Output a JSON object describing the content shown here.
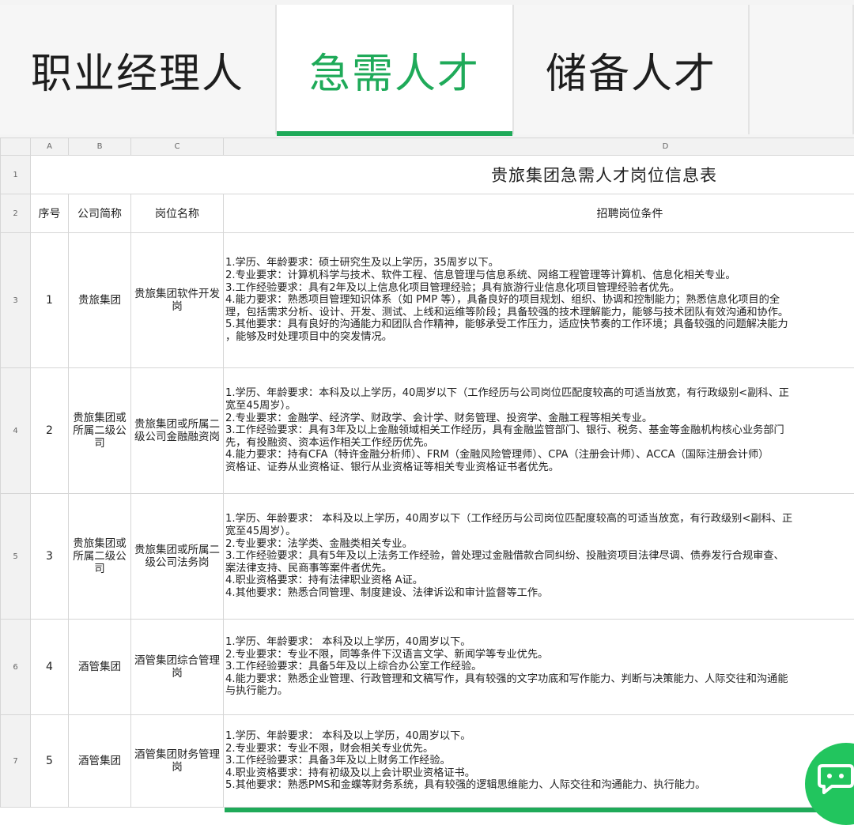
{
  "tabs": [
    {
      "label": "职业经理人",
      "active": false
    },
    {
      "label": "急需人才",
      "active": true
    },
    {
      "label": "储备人才",
      "active": false
    },
    {
      "label": "",
      "active": false
    }
  ],
  "accent_color": "#1faa59",
  "sheet": {
    "column_headers": [
      "A",
      "B",
      "C",
      "D"
    ],
    "row_numbers": [
      "1",
      "2",
      "3",
      "4",
      "5",
      "6",
      "7"
    ],
    "title": "贵旅集团急需人才岗位信息表",
    "header_row": {
      "seq": "序号",
      "company": "公司简称",
      "position": "岗位名称",
      "requirements": "招聘岗位条件"
    },
    "rows": [
      {
        "seq": "1",
        "company": "贵旅集团",
        "position": "贵旅集团软件开发岗",
        "requirements": [
          "1.学历、年龄要求：硕士研究生及以上学历，35周岁以下。",
          "2.专业要求：计算机科学与技术、软件工程、信息管理与信息系统、网络工程管理等计算机、信息化相关专业。",
          "3.工作经验要求：具有2年及以上信息化项目管理经验；具有旅游行业信息化项目管理经验者优先。",
          "4.能力要求：熟悉项目管理知识体系（如 PMP 等），具备良好的项目规划、组织、协调和控制能力；熟悉信息化项目的全",
          "理，包括需求分析、设计、开发、测试、上线和运维等阶段；具备较强的技术理解能力，能够与技术团队有效沟通和协作。",
          "5.其他要求：具有良好的沟通能力和团队合作精神，能够承受工作压力，适应快节奏的工作环境；具备较强的问题解决能力",
          "，能够及时处理项目中的突发情况。"
        ]
      },
      {
        "seq": "2",
        "company": "贵旅集团或所属二级公司",
        "position": "贵旅集团或所属二级公司金融融资岗",
        "requirements": [
          "1.学历、年龄要求：本科及以上学历，40周岁以下（工作经历与公司岗位匹配度较高的可适当放宽，有行政级别<副科、正",
          "宽至45周岁）。",
          "2.专业要求：金融学、经济学、财政学、会计学、财务管理、投资学、金融工程等相关专业。",
          "3.工作经验要求：具有3年及以上金融领域相关工作经历，具有金融监管部门、银行、税务、基金等金融机构核心业务部门",
          "先，有投融资、资本运作相关工作经历优先。",
          "4.能力要求：持有CFA（特许金融分析师）、FRM（金融风险管理师）、CPA（注册会计师）、ACCA（国际注册会计师）",
          "资格证、证券从业资格证、银行从业资格证等相关专业资格证书者优先。"
        ]
      },
      {
        "seq": "3",
        "company": "贵旅集团或所属二级公司",
        "position": "贵旅集团或所属二级公司法务岗",
        "requirements": [
          "1.学历、年龄要求： 本科及以上学历，40周岁以下（工作经历与公司岗位匹配度较高的可适当放宽，有行政级别<副科、正",
          "宽至45周岁）。",
          "2.专业要求：法学类、金融类相关专业。",
          "3.工作经验要求：具有5年及以上法务工作经验，曾处理过金融借款合同纠纷、投融资项目法律尽调、债券发行合规审查、",
          "案法律支持、民商事等案件者优先。",
          "4.职业资格要求：持有法律职业资格 A证。",
          "4.其他要求：熟悉合同管理、制度建设、法律诉讼和审计监督等工作。"
        ]
      },
      {
        "seq": "4",
        "company": "酒管集团",
        "position": "酒管集团综合管理岗",
        "requirements": [
          "1.学历、年龄要求： 本科及以上学历，40周岁以下。",
          "2.专业要求：专业不限，同等条件下汉语言文学、新闻学等专业优先。",
          "3.工作经验要求：具备5年及以上综合办公室工作经验。",
          "4.能力要求：熟悉企业管理、行政管理和文稿写作，具有较强的文字功底和写作能力、判断与决策能力、人际交往和沟通能",
          "与执行能力。"
        ]
      },
      {
        "seq": "5",
        "company": "酒管集团",
        "position": "酒管集团财务管理岗",
        "requirements": [
          "1.学历、年龄要求： 本科及以上学历，40周岁以下。",
          "2.专业要求：专业不限，财会相关专业优先。",
          "3.工作经验要求：具备3年及以上财务工作经验。",
          "4.职业资格要求：持有初级及以上会计职业资格证书。",
          "5.其他要求：熟悉PMS和金蝶等财务系统，具有较强的逻辑思维能力、人际交往和沟通能力、执行能力。"
        ]
      }
    ]
  },
  "chat_button_icon": "chat-bubble-icon"
}
